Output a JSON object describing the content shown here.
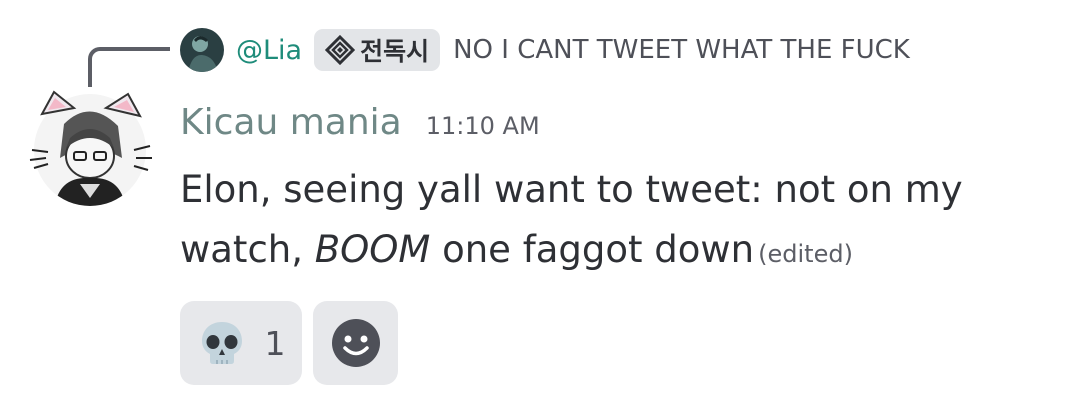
{
  "reply": {
    "author": "@Lia",
    "clan_tag": "전독시",
    "text": "NO I CANT TWEET WHAT THE FUCK",
    "avatar_icon": "lia-avatar",
    "clan_icon": "diamond-badge-icon"
  },
  "message": {
    "username": "Kicau mania",
    "timestamp": "11:10 AM",
    "line1": "Elon, seeing yall want to tweet: not on my",
    "line2_before": "watch, ",
    "line2_emphasis": "BOOM",
    "line2_after": " one faggot down",
    "edited_label": "(edited)",
    "avatar_icon": "cat-ear-anime-avatar"
  },
  "reactions": [
    {
      "emoji_icon": "skull-icon",
      "count": "1"
    }
  ],
  "add_reaction_icon": "smiley-add-icon",
  "colors": {
    "reply_author": "#1e8c7a",
    "username": "#6f8886",
    "text": "#2e3035",
    "muted": "#5c5e66",
    "chip_background": "#e7e8eb"
  }
}
